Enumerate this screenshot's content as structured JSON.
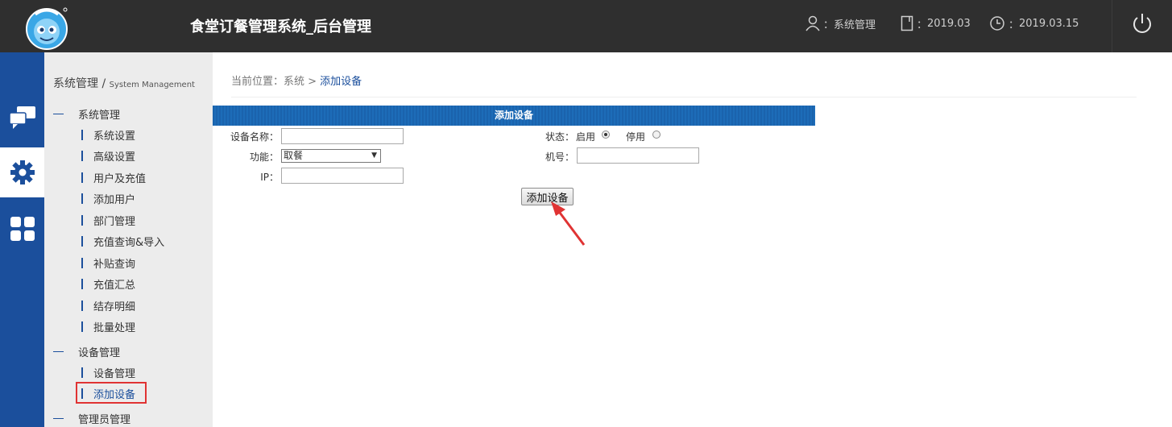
{
  "header": {
    "title": "食堂订餐管理系统_后台管理",
    "user_label": "系统管理",
    "version": "2019.03",
    "date": "2019.03.15"
  },
  "rail": {
    "items": [
      {
        "icon": "chat-bubbles-icon"
      },
      {
        "icon": "gear-icon",
        "active": true
      },
      {
        "icon": "grid-apps-icon"
      }
    ]
  },
  "sidebar": {
    "title": "系统管理",
    "title_sep": "/",
    "title_en": "System Management",
    "group_system": "系统管理",
    "system_items": [
      "系统设置",
      "高级设置",
      "用户及充值",
      "添加用户",
      "部门管理",
      "充值查询&导入",
      "补贴查询",
      "充值汇总",
      "结存明细",
      "批量处理"
    ],
    "group_device": "设备管理",
    "device_items": [
      "设备管理",
      "添加设备"
    ],
    "group_admin": "管理员管理"
  },
  "breadcrumb": {
    "prefix": "当前位置：系统 >",
    "current": "添加设备"
  },
  "form": {
    "header": "添加设备",
    "device_name_label": "设备名称：",
    "device_name_value": "",
    "function_label": "功能：",
    "function_value": "取餐",
    "ip_label": "IP：",
    "ip_value": "",
    "status_label": "状态：",
    "status_enabled": "启用",
    "status_disabled": "停用",
    "machine_no_label": "机号：",
    "machine_no_value": "",
    "submit_label": "添加设备"
  },
  "colors": {
    "topbar": "#2f2f2f",
    "rail": "#1b4f9c",
    "sidebar": "#ececec",
    "form_header": "#1a63ad",
    "highlight": "#e03333"
  }
}
